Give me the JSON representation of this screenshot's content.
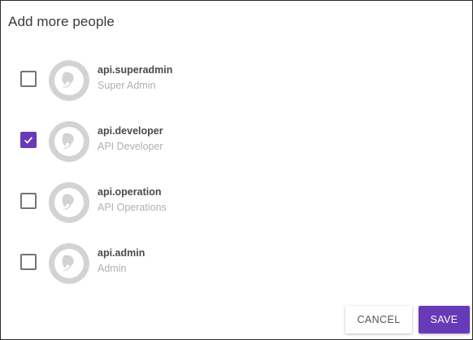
{
  "dialog": {
    "title": "Add more people"
  },
  "people": [
    {
      "name": "api.superadmin",
      "role": "Super Admin",
      "checked": false
    },
    {
      "name": "api.developer",
      "role": "API Developer",
      "checked": true
    },
    {
      "name": "api.operation",
      "role": "API Operations",
      "checked": false
    },
    {
      "name": "api.admin",
      "role": "Admin",
      "checked": false
    }
  ],
  "actions": {
    "cancel_label": "CANCEL",
    "save_label": "SAVE"
  },
  "colors": {
    "accent": "#673ab7",
    "avatar_bg": "#d3d3d3"
  },
  "icons": {
    "checkbox_mark": "checkmark-icon",
    "avatar": "avatar-logo-icon"
  }
}
